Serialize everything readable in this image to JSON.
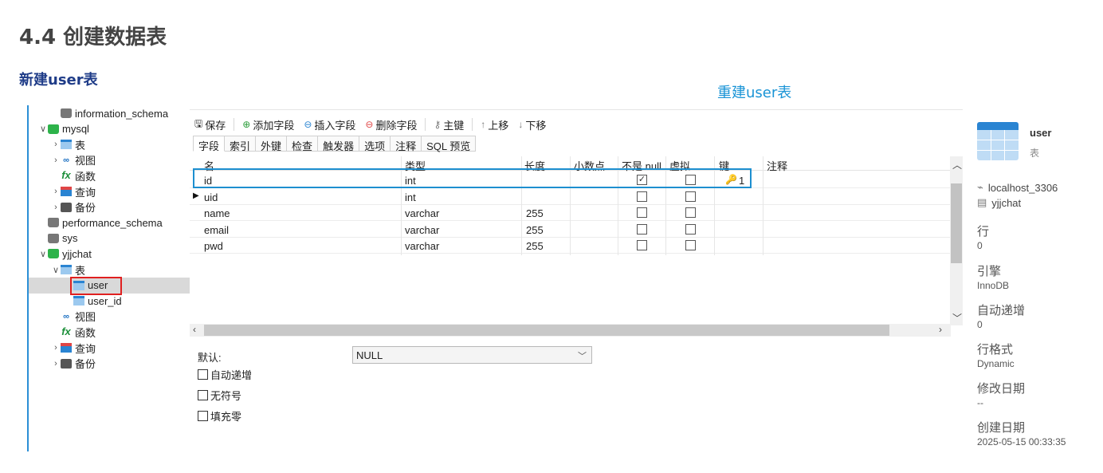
{
  "page": {
    "title": "4.4 创建数据表",
    "subtitle": "新建user表",
    "annotation": "重建user表"
  },
  "tree": [
    {
      "label": "information_schema",
      "icon": "database-icon",
      "depth": 1
    },
    {
      "label": "mysql",
      "icon": "database-green-icon",
      "depth": 0,
      "chev": "∨"
    },
    {
      "label": "表",
      "icon": "table-icon",
      "depth": 1,
      "chev": "›"
    },
    {
      "label": "视图",
      "icon": "view-icon",
      "depth": 1,
      "chev": "›"
    },
    {
      "label": "函数",
      "icon": "function-icon",
      "depth": 1
    },
    {
      "label": "查询",
      "icon": "query-icon",
      "depth": 1,
      "chev": "›"
    },
    {
      "label": "备份",
      "icon": "backup-icon",
      "depth": 1,
      "chev": "›"
    },
    {
      "label": "performance_schema",
      "icon": "database-icon",
      "depth": 0
    },
    {
      "label": "sys",
      "icon": "database-icon",
      "depth": 0
    },
    {
      "label": "yjjchat",
      "icon": "database-green-icon",
      "depth": 0,
      "chev": "∨"
    },
    {
      "label": "表",
      "icon": "table-icon",
      "depth": 1,
      "chev": "∨"
    },
    {
      "label": "user",
      "icon": "table-icon",
      "depth": 2,
      "selected": true
    },
    {
      "label": "user_id",
      "icon": "table-icon",
      "depth": 2
    },
    {
      "label": "视图",
      "icon": "view-icon",
      "depth": 1
    },
    {
      "label": "函数",
      "icon": "function-icon",
      "depth": 1
    },
    {
      "label": "查询",
      "icon": "query-icon",
      "depth": 1,
      "chev": "›"
    },
    {
      "label": "备份",
      "icon": "backup-icon",
      "depth": 1,
      "chev": "›"
    }
  ],
  "toolbar": {
    "save": "保存",
    "add_field": "添加字段",
    "insert_field": "插入字段",
    "delete_field": "删除字段",
    "primary_key": "主键",
    "move_up": "上移",
    "move_down": "下移"
  },
  "tabs": [
    "字段",
    "索引",
    "外键",
    "检查",
    "触发器",
    "选项",
    "注释",
    "SQL 预览"
  ],
  "grid": {
    "headers": [
      "名",
      "类型",
      "长度",
      "小数点",
      "不是 null",
      "虚拟",
      "键",
      "注释"
    ],
    "rows": [
      {
        "name": "id",
        "type": "int",
        "length": "",
        "decimals": "",
        "not_null": true,
        "virtual": false,
        "key": "1"
      },
      {
        "name": "uid",
        "type": "int",
        "length": "",
        "decimals": "",
        "not_null": false,
        "virtual": false,
        "key": ""
      },
      {
        "name": "name",
        "type": "varchar",
        "length": "255",
        "decimals": "",
        "not_null": false,
        "virtual": false,
        "key": ""
      },
      {
        "name": "email",
        "type": "varchar",
        "length": "255",
        "decimals": "",
        "not_null": false,
        "virtual": false,
        "key": ""
      },
      {
        "name": "pwd",
        "type": "varchar",
        "length": "255",
        "decimals": "",
        "not_null": false,
        "virtual": false,
        "key": ""
      }
    ]
  },
  "field_props": {
    "default_label": "默认:",
    "default_value": "NULL",
    "auto_increment": "自动递增",
    "unsigned": "无符号",
    "zerofill": "填充零"
  },
  "info": {
    "name": "user",
    "type": "表",
    "connection": "localhost_3306",
    "database": "yjjchat",
    "rows_label": "行",
    "rows_value": "0",
    "engine_label": "引擎",
    "engine_value": "InnoDB",
    "auto_inc_label": "自动递增",
    "auto_inc_value": "0",
    "row_format_label": "行格式",
    "row_format_value": "Dynamic",
    "modified_label": "修改日期",
    "modified_value": "--",
    "created_label": "创建日期",
    "created_value": "2025-05-15 00:33:35"
  },
  "colors": {
    "accent_blue": "#1d8fd0",
    "selection_red": "#e02020",
    "subtitle_blue": "#1f3c88"
  }
}
